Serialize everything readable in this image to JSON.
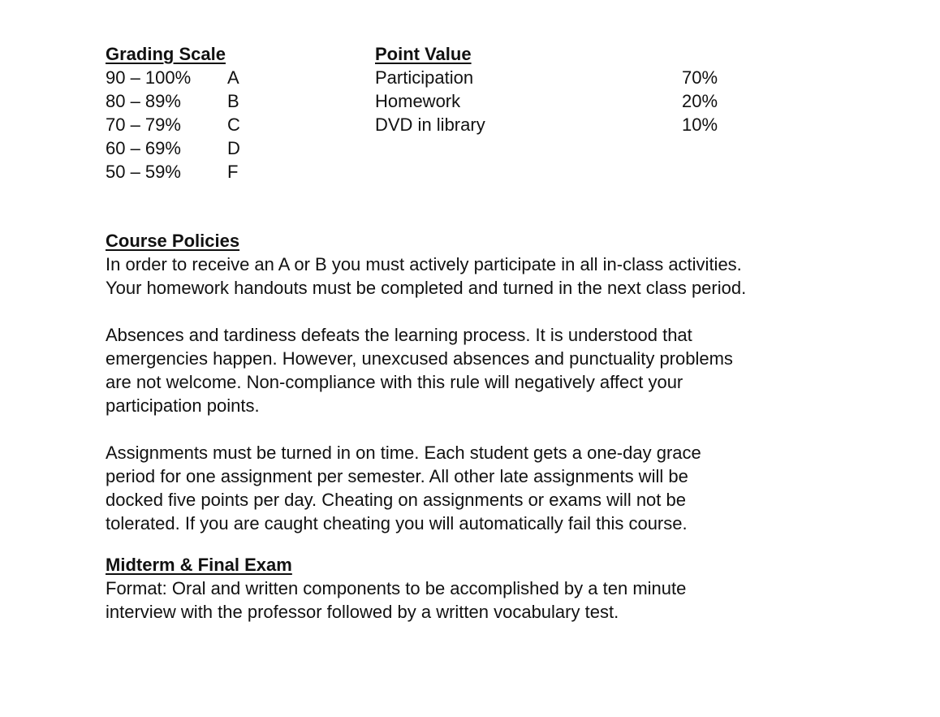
{
  "grading_scale": {
    "heading": "Grading Scale",
    "rows": [
      {
        "range": "90 – 100%",
        "grade": "A"
      },
      {
        "range": "80 – 89%",
        "grade": "B"
      },
      {
        "range": "70 – 79%",
        "grade": "C"
      },
      {
        "range": "60 – 69%",
        "grade": "D"
      },
      {
        "range": "50 – 59%",
        "grade": "F"
      }
    ]
  },
  "point_value": {
    "heading": "Point Value",
    "rows": [
      {
        "item": "Participation",
        "percent": "70%"
      },
      {
        "item": "Homework",
        "percent": "20%"
      },
      {
        "item": "DVD in library",
        "percent": "10%"
      }
    ]
  },
  "course_policies": {
    "heading": "Course Policies",
    "paragraphs": [
      [
        "In order to receive an A or B you must actively participate in all in-class activities.",
        "Your homework handouts must be completed and turned in the next class period."
      ],
      [
        "Absences and tardiness defeats the learning process.  It is understood that",
        "emergencies happen.  However, unexcused absences and punctuality problems",
        "are not welcome.  Non-compliance with this rule will negatively affect your",
        "participation points."
      ],
      [
        "Assignments must be turned in on time.  Each student gets a one-day grace",
        "period for one assignment per semester.  All other late assignments will be",
        "docked five points per day.  Cheating on assignments or exams will not be",
        "tolerated.  If you are caught cheating you will automatically fail this course."
      ]
    ]
  },
  "midterm_final": {
    "heading": "Midterm & Final Exam",
    "lines": [
      "Format:  Oral and written components to be accomplished by a ten minute",
      "interview with the professor followed by a written vocabulary test."
    ]
  }
}
